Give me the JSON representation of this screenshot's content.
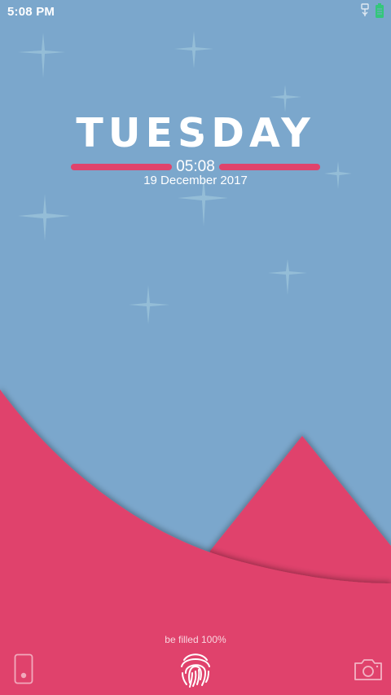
{
  "status_bar": {
    "time": "5:08 PM",
    "icons": [
      "usb-icon",
      "battery-charging-icon"
    ]
  },
  "lock_screen": {
    "day": "TUESDAY",
    "time": "05:08",
    "date": "19 December 2017",
    "fill_status": "be filled 100%"
  },
  "shortcuts": {
    "left": "phone-icon",
    "center": "fingerprint-icon",
    "right": "camera-icon"
  },
  "colors": {
    "sky": "#7ba7cc",
    "accent": "#e0436c",
    "text": "#ffffff"
  }
}
